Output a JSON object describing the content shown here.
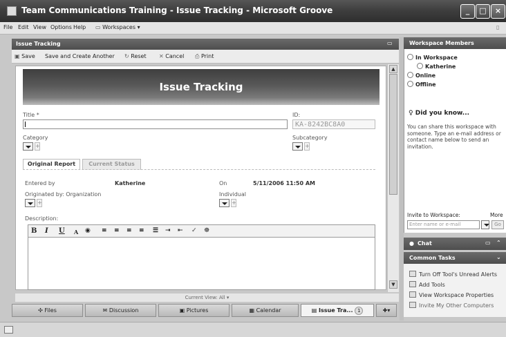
{
  "window": {
    "title": "Team Communications Training - Issue Tracking - Microsoft Groove"
  },
  "menu": {
    "file": "File",
    "edit": "Edit",
    "view": "View",
    "options": "Options",
    "help": "Help",
    "workspaces": "Workspaces"
  },
  "tool_panel": {
    "title": "Issue Tracking"
  },
  "toolbar": {
    "save": "Save",
    "save_another": "Save and Create Another",
    "reset": "Reset",
    "cancel": "Cancel",
    "print": "Print"
  },
  "form": {
    "banner": "Issue Tracking",
    "title_label": "Title *",
    "id_label": "ID:",
    "id_value": "KA-8242BC8A0",
    "category_label": "Category",
    "subcategory_label": "Subcategory",
    "tabs": [
      "Original Report",
      "Current Status"
    ],
    "entered_by_label": "Entered by",
    "entered_by_value": "Katherine",
    "on_label": "On",
    "on_value": "5/11/2006 11:50 AM",
    "originated_label": "Originated by: Organization",
    "individual_label": "Individual",
    "description_label": "Description:",
    "rte": {
      "bold": "B",
      "italic": "I",
      "underline": "U",
      "fontsize": "A"
    }
  },
  "current_view": "Current View: All",
  "bottom_tabs": [
    {
      "label": "Files"
    },
    {
      "label": "Discussion"
    },
    {
      "label": "Pictures"
    },
    {
      "label": "Calendar"
    },
    {
      "label": "Issue Tra...",
      "badge": "1"
    }
  ],
  "members": {
    "title": "Workspace Members",
    "in_workspace": "In Workspace",
    "member": "Katherine",
    "online": "Online",
    "offline": "Offline",
    "did_you_know": "Did you know...",
    "tip": "You can share this workspace with someone.  Type an e-mail address or contact name below to send an invitation.",
    "invite_label": "Invite to Workspace:",
    "more": "More",
    "invite_placeholder": "Enter name or e-mail",
    "go": "Go"
  },
  "chat": {
    "title": "Chat"
  },
  "tasks": {
    "title": "Common Tasks",
    "items": [
      "Turn Off Tool's Unread Alerts",
      "Add Tools",
      "View Workspace Properties",
      "Invite My Other Computers"
    ]
  },
  "colors": {
    "header_dark": "#4e4e4e",
    "panel_bg": "#c8c8c8",
    "banner": "#585858"
  }
}
